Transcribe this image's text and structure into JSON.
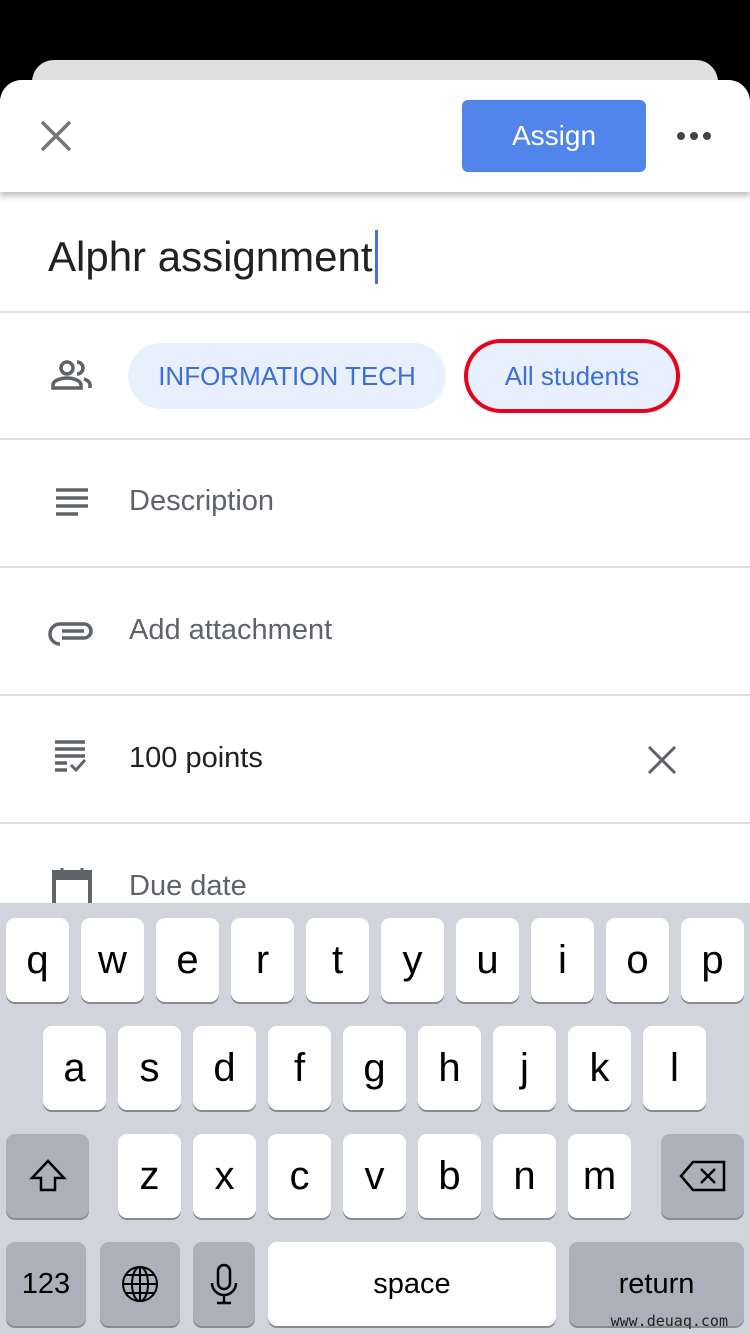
{
  "header": {
    "close_icon": "close-icon",
    "assign_label": "Assign",
    "more_icon": "more-horiz-icon",
    "accent": "#5285ec"
  },
  "title": {
    "value": "Alphr assignment"
  },
  "recipients": {
    "icon": "people-icon",
    "class_chip": "INFORMATION TECH",
    "students_chip": "All students",
    "highlight": "#e8001c"
  },
  "rows": [
    {
      "icon": "description-icon",
      "text": "Description"
    },
    {
      "icon": "attachment-icon",
      "text": "Add attachment"
    },
    {
      "icon": "grading-icon",
      "text": "100 points",
      "clear_icon": "close-icon"
    },
    {
      "icon": "calendar-icon",
      "text": "Due date"
    }
  ],
  "keyboard": {
    "row1": [
      "q",
      "w",
      "e",
      "r",
      "t",
      "y",
      "u",
      "i",
      "o",
      "p"
    ],
    "row2": [
      "a",
      "s",
      "d",
      "f",
      "g",
      "h",
      "j",
      "k",
      "l"
    ],
    "row3": [
      "z",
      "x",
      "c",
      "v",
      "b",
      "n",
      "m"
    ],
    "numbers": "123",
    "space": "space",
    "return": "return",
    "shift_icon": "shift-icon",
    "backspace_icon": "backspace-icon",
    "globe_icon": "globe-icon",
    "mic_icon": "microphone-icon"
  },
  "watermark": "www.deuaq.com"
}
